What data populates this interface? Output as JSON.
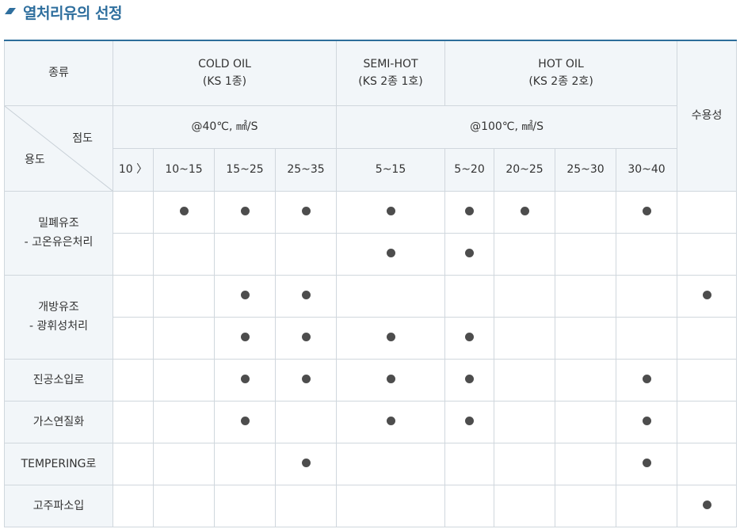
{
  "title": "열처리유의 선정",
  "accent_color": "#2f6f9e",
  "table": {
    "header_kind": "종류",
    "cold_oil": "COLD OIL",
    "cold_oil_std": "(KS 1종)",
    "semi_hot": "SEMI-HOT",
    "semi_hot_std": "(KS 2종 1호)",
    "hot_oil": "HOT OIL",
    "hot_oil_std": "(KS 2종 2호)",
    "water_soluble": "수용성",
    "viscosity": "점도",
    "usage": "용도",
    "visc_40": "@40℃, ㎟/S",
    "visc_100": "@100℃, ㎟/S",
    "ranges": [
      "10 〉",
      "10~15",
      "15~25",
      "25~35",
      "5~15",
      "5~20",
      "20~25",
      "25~30",
      "30~40"
    ],
    "rows": [
      {
        "usage_line1": "밀폐유조",
        "usage_line2": "- 고온유은처리"
      },
      {
        "usage_line1": "개방유조",
        "usage_line2": "- 광휘성처리"
      },
      {
        "usage": "진공소입로"
      },
      {
        "usage": "가스연질화"
      },
      {
        "usage": "TEMPERING로"
      },
      {
        "usage": "고주파소입"
      }
    ]
  }
}
